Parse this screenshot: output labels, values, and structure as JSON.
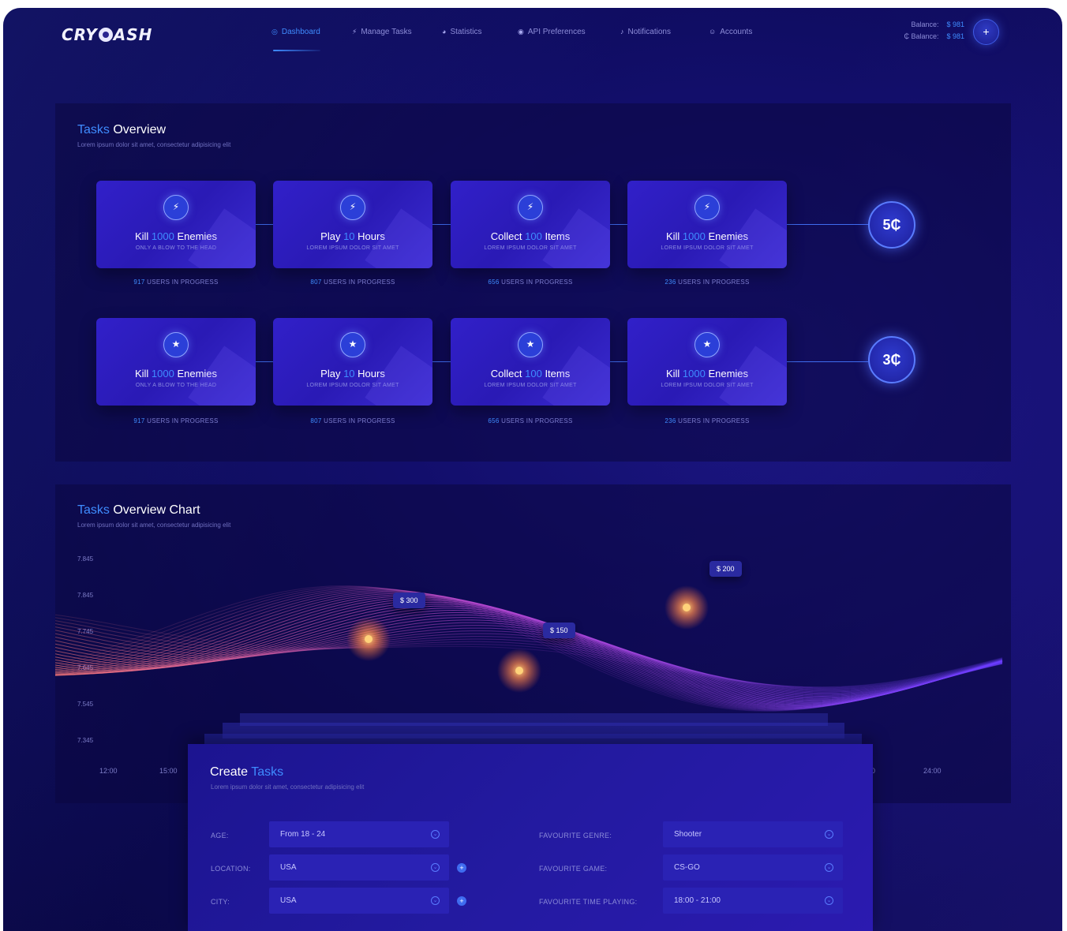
{
  "brand": {
    "logo_left": "CRY",
    "logo_right": "ASH"
  },
  "nav": {
    "items": [
      {
        "label": "Dashboard",
        "icon": "dashboard-icon"
      },
      {
        "label": "Manage Tasks",
        "icon": "bolt-icon"
      },
      {
        "label": "Statistics",
        "icon": "pie-chart-icon"
      },
      {
        "label": "API Preferences",
        "icon": "target-icon"
      },
      {
        "label": "Notifications",
        "icon": "bell-icon"
      },
      {
        "label": "Accounts",
        "icon": "user-icon"
      }
    ],
    "active": "Dashboard"
  },
  "balance": {
    "row1_label": "Balance:",
    "row1_value": "$ 981",
    "row2_label": "₵ Balance:",
    "row2_value": "$ 981"
  },
  "add_button": "+",
  "tasks_overview": {
    "title_hl": "Tasks",
    "title_rest": " Overview",
    "subtitle": "Lorem ipsum dolor sit amet, consectetur adipisicing elit",
    "rows": [
      {
        "badge_icon": "bolt-icon",
        "badge_glyph": "⚡",
        "reward": "5₵",
        "cards": [
          {
            "pre": "Kill ",
            "num": "1000",
            "post": " Enemies",
            "sub": "ONLY A BLOW TO THE HEAD",
            "users_num": "917",
            "users_text": " USERS IN PROGRESS"
          },
          {
            "pre": "Play ",
            "num": "10",
            "post": " Hours",
            "sub": "LOREM IPSUM DOLOR SIT AMET",
            "users_num": "807",
            "users_text": " USERS IN PROGRESS"
          },
          {
            "pre": "Collect ",
            "num": "100",
            "post": " Items",
            "sub": "LOREM IPSUM DOLOR SIT AMET",
            "users_num": "656",
            "users_text": " USERS IN PROGRESS"
          },
          {
            "pre": "Kill ",
            "num": "1000",
            "post": " Enemies",
            "sub": "LOREM IPSUM DOLOR SIT AMET",
            "users_num": "236",
            "users_text": " USERS IN PROGRESS"
          }
        ]
      },
      {
        "badge_icon": "star-icon",
        "badge_glyph": "★",
        "reward": "3₵",
        "cards": [
          {
            "pre": "Kill ",
            "num": "1000",
            "post": " Enemies",
            "sub": "ONLY A BLOW TO THE HEAD",
            "users_num": "917",
            "users_text": " USERS IN PROGRESS"
          },
          {
            "pre": "Play ",
            "num": "10",
            "post": " Hours",
            "sub": "LOREM IPSUM DOLOR SIT AMET",
            "users_num": "807",
            "users_text": " USERS IN PROGRESS"
          },
          {
            "pre": "Collect ",
            "num": "100",
            "post": " Items",
            "sub": "LOREM IPSUM DOLOR SIT AMET",
            "users_num": "656",
            "users_text": " USERS IN PROGRESS"
          },
          {
            "pre": "Kill ",
            "num": "1000",
            "post": " Enemies",
            "sub": "LOREM IPSUM DOLOR SIT AMET",
            "users_num": "236",
            "users_text": " USERS IN PROGRESS"
          }
        ]
      }
    ]
  },
  "chart": {
    "title_hl": "Tasks",
    "title_rest": " Overview Chart",
    "subtitle": "Lorem ipsum dolor sit amet, consectetur adipisicing elit",
    "y_ticks": [
      "7.845",
      "7.845",
      "7.745",
      "7.645",
      "7.545",
      "7.345"
    ],
    "x_ticks_visible": [
      "12:00",
      "15:00",
      "0",
      "24:00"
    ],
    "tooltips": [
      "$ 300",
      "$ 150",
      "$ 200"
    ]
  },
  "chart_data": {
    "type": "line",
    "yticks": [
      "7.845",
      "7.845",
      "7.745",
      "7.645",
      "7.545",
      "7.345"
    ],
    "xticks": [
      "12:00",
      "15:00",
      "24:00"
    ],
    "highlighted_points": [
      {
        "label": "$ 300"
      },
      {
        "label": "$ 150"
      },
      {
        "label": "$ 200"
      }
    ],
    "colors": {
      "start": "#ff7a7a",
      "mid": "#c04ad8",
      "end": "#6a3cff"
    }
  },
  "create_tasks": {
    "title_pre": "Create ",
    "title_hl": "Tasks",
    "subtitle": "Lorem ipsum dolor sit amet, consectetur adipisicing elit",
    "left_fields": [
      {
        "label": "AGE:",
        "value": "From 18 - 24"
      },
      {
        "label": "LOCATION:",
        "value": "USA"
      },
      {
        "label": "CITY:",
        "value": "USA"
      }
    ],
    "right_fields": [
      {
        "label": "FAVOURITE GENRE:",
        "value": "Shooter"
      },
      {
        "label": "FAVOURITE GAME:",
        "value": "CS-GO"
      },
      {
        "label": "FAVOURITE TIME PLAYING:",
        "value": "18:00 - 21:00"
      }
    ]
  },
  "colors": {
    "accent": "#3f8cff",
    "background": "#0c0a52",
    "card": "#3120c9"
  }
}
